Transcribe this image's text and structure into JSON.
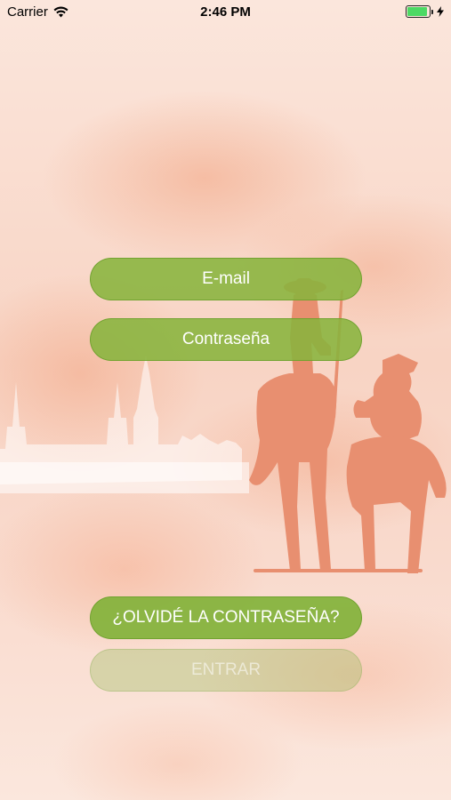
{
  "status_bar": {
    "carrier": "Carrier",
    "time": "2:46 PM"
  },
  "login": {
    "email_placeholder": "E-mail",
    "password_placeholder": "Contraseña",
    "forgot_label": "¿OLVIDÉ LA CONTRASEÑA?",
    "enter_label": "ENTRAR"
  },
  "colors": {
    "button_green": "#87b43c",
    "silhouette": "#e88f70",
    "background": "#f9dacd"
  },
  "icons": [
    "wifi-icon",
    "battery-icon",
    "charging-icon"
  ]
}
